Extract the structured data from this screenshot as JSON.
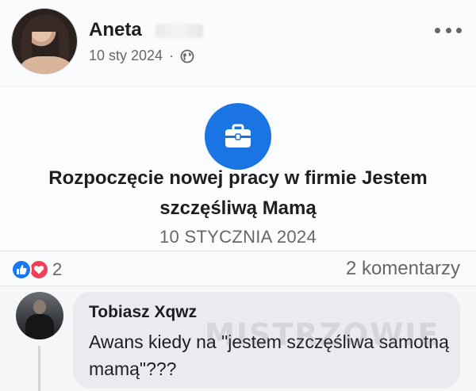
{
  "post": {
    "author_name": "Aneta",
    "date": "10 sty 2024",
    "meta_separator": "·",
    "privacy_icon": "globe-icon",
    "more_icon": "more-horizontal-icon"
  },
  "life_event": {
    "icon": "briefcase-icon",
    "title": "Rozpoczęcie nowej pracy w firmie Jestem szczęśliwą Mamą",
    "date": "10 STYCZNIA 2024",
    "accent": "#1b74e4"
  },
  "reactions": {
    "icons": [
      "like-icon",
      "love-icon"
    ],
    "count": "2",
    "comments_label": "2 komentarzy",
    "like_color": "#1877f2",
    "love_color": "#f33e58"
  },
  "comment": {
    "author": "Tobiasz Xqwz",
    "text": "Awans kiedy na \"jestem szczęśliwa samotną mamą\"???"
  },
  "watermark": {
    "text": "MISTRZOWIE"
  }
}
